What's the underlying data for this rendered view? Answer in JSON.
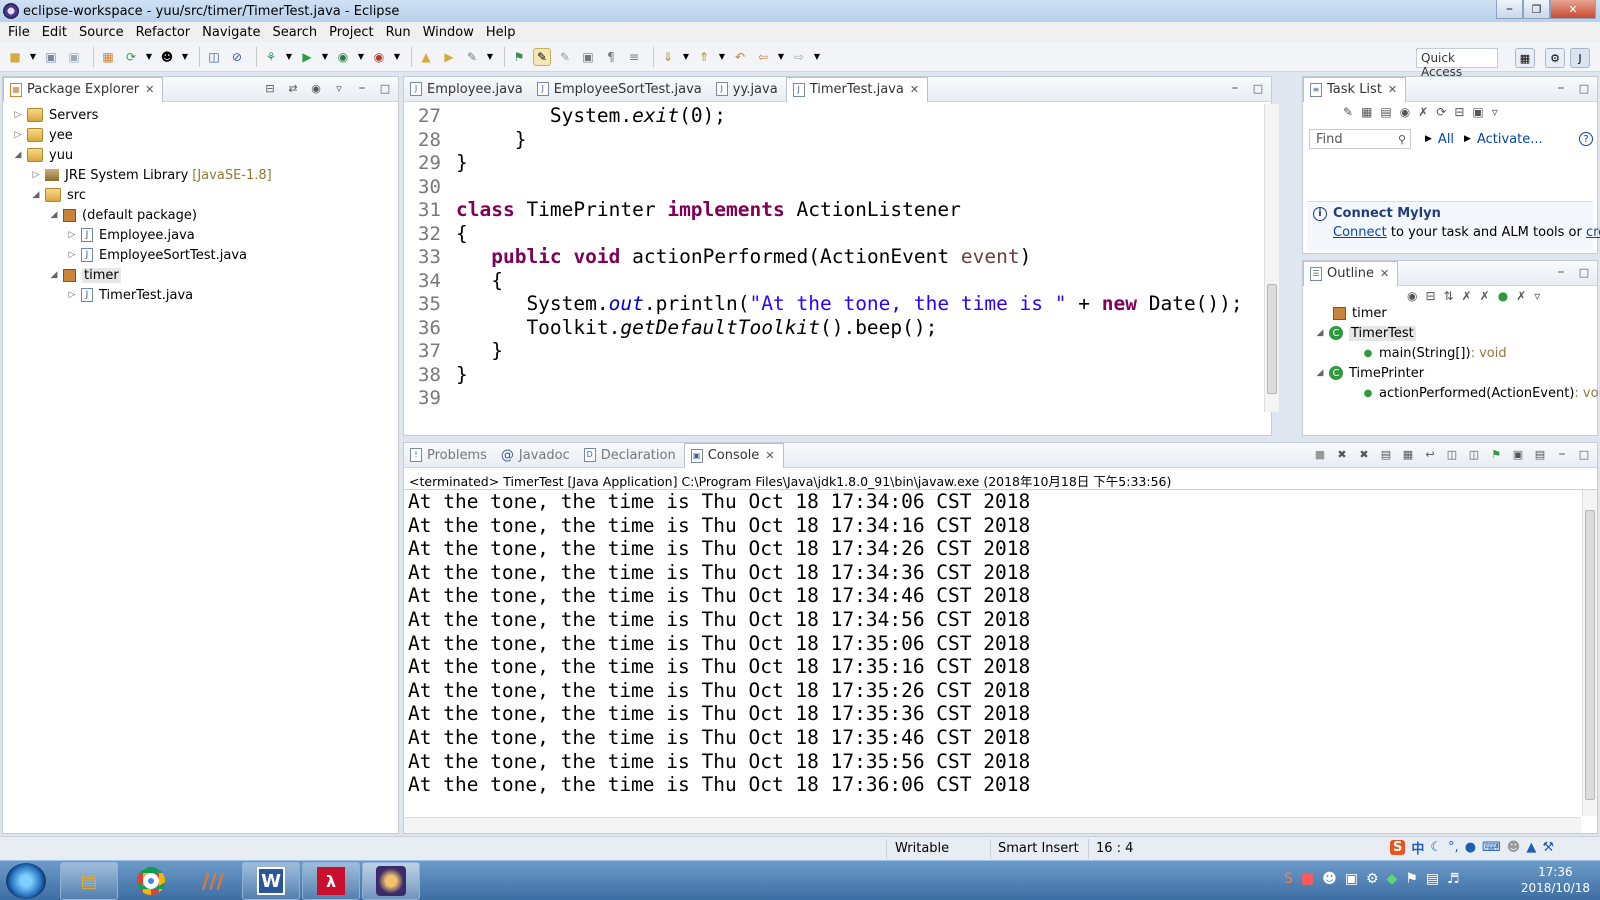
{
  "window": {
    "title": "eclipse-workspace - yuu/src/timer/TimerTest.java - Eclipse"
  },
  "menu": [
    "File",
    "Edit",
    "Source",
    "Refactor",
    "Navigate",
    "Search",
    "Project",
    "Run",
    "Window",
    "Help"
  ],
  "toolbar": {
    "quick_access": "Quick Access"
  },
  "package_explorer": {
    "tab": "Package Explorer",
    "items": {
      "servers": "Servers",
      "yee": "yee",
      "yuu": "yuu",
      "jre": "JRE System Library",
      "jre_version": "[JavaSE-1.8]",
      "src": "src",
      "default_pkg": "(default package)",
      "employee": "Employee.java",
      "employee_sort": "EmployeeSortTest.java",
      "timer": "timer",
      "timertest": "TimerTest.java"
    }
  },
  "editor": {
    "tabs": [
      "Employee.java",
      "EmployeeSortTest.java",
      "yy.java",
      "TimerTest.java"
    ],
    "active_tab": "TimerTest.java",
    "line_numbers": [
      "27",
      "28",
      "29",
      "30",
      "31",
      "32",
      "33",
      "34",
      "35",
      "36",
      "37",
      "38",
      "39"
    ],
    "code": {
      "l27_a": "        System.",
      "l27_b": "exit",
      "l27_c": "(0);",
      "l28": "     }",
      "l29": "}",
      "l31_kw1": "class",
      "l31_a": " TimePrinter ",
      "l31_kw2": "implements",
      "l31_b": " ActionListener",
      "l32": "{",
      "l33_kw1": "public",
      "l33_kw2": "void",
      "l33_a": " actionPerformed(ActionEvent ",
      "l33_param": "event",
      "l33_b": ")",
      "l34": "   {",
      "l35_a": "      System.",
      "l35_fld": "out",
      "l35_b": ".println(",
      "l35_str": "\"At the tone, the time is \"",
      "l35_c": " + ",
      "l35_kw": "new",
      "l35_d": " Date());",
      "l36_a": "      Toolkit.",
      "l36_b": "getDefaultToolkit",
      "l36_c": "().beep();",
      "l37": "   }",
      "l38": "}"
    }
  },
  "task_list": {
    "tab": "Task List",
    "find_placeholder": "Find",
    "all": "All",
    "activate": "Activate...",
    "connect_title": "Connect Mylyn",
    "connect_link": "Connect",
    "connect_text": " to your task and ALM tools or ",
    "create_link": "create"
  },
  "outline": {
    "tab": "Outline",
    "items": {
      "timer": "timer",
      "timertest": "TimerTest",
      "main": "main(String[])",
      "main_type": " : void",
      "timeprinter": "TimePrinter",
      "action": "actionPerformed(ActionEvent)",
      "action_type": " : void"
    }
  },
  "bottom_tabs": [
    "Problems",
    "Javadoc",
    "Declaration",
    "Console"
  ],
  "console": {
    "header": "<terminated> TimerTest [Java Application] C:\\Program Files\\Java\\jdk1.8.0_91\\bin\\javaw.exe (2018年10月18日 下午5:33:56)",
    "lines": [
      "At the tone, the time is Thu Oct 18 17:34:06 CST 2018",
      "At the tone, the time is Thu Oct 18 17:34:16 CST 2018",
      "At the tone, the time is Thu Oct 18 17:34:26 CST 2018",
      "At the tone, the time is Thu Oct 18 17:34:36 CST 2018",
      "At the tone, the time is Thu Oct 18 17:34:46 CST 2018",
      "At the tone, the time is Thu Oct 18 17:34:56 CST 2018",
      "At the tone, the time is Thu Oct 18 17:35:06 CST 2018",
      "At the tone, the time is Thu Oct 18 17:35:16 CST 2018",
      "At the tone, the time is Thu Oct 18 17:35:26 CST 2018",
      "At the tone, the time is Thu Oct 18 17:35:36 CST 2018",
      "At the tone, the time is Thu Oct 18 17:35:46 CST 2018",
      "At the tone, the time is Thu Oct 18 17:35:56 CST 2018",
      "At the tone, the time is Thu Oct 18 17:36:06 CST 2018"
    ]
  },
  "status": {
    "writable": "Writable",
    "insert_mode": "Smart Insert",
    "position": "16 : 4"
  },
  "taskbar": {
    "time": "17:36",
    "date": "2018/10/18",
    "word_label": "W"
  },
  "colors": {
    "keyword": "#7f0055",
    "string": "#2a00ff",
    "field": "#0000c0",
    "link": "#0645ad"
  }
}
